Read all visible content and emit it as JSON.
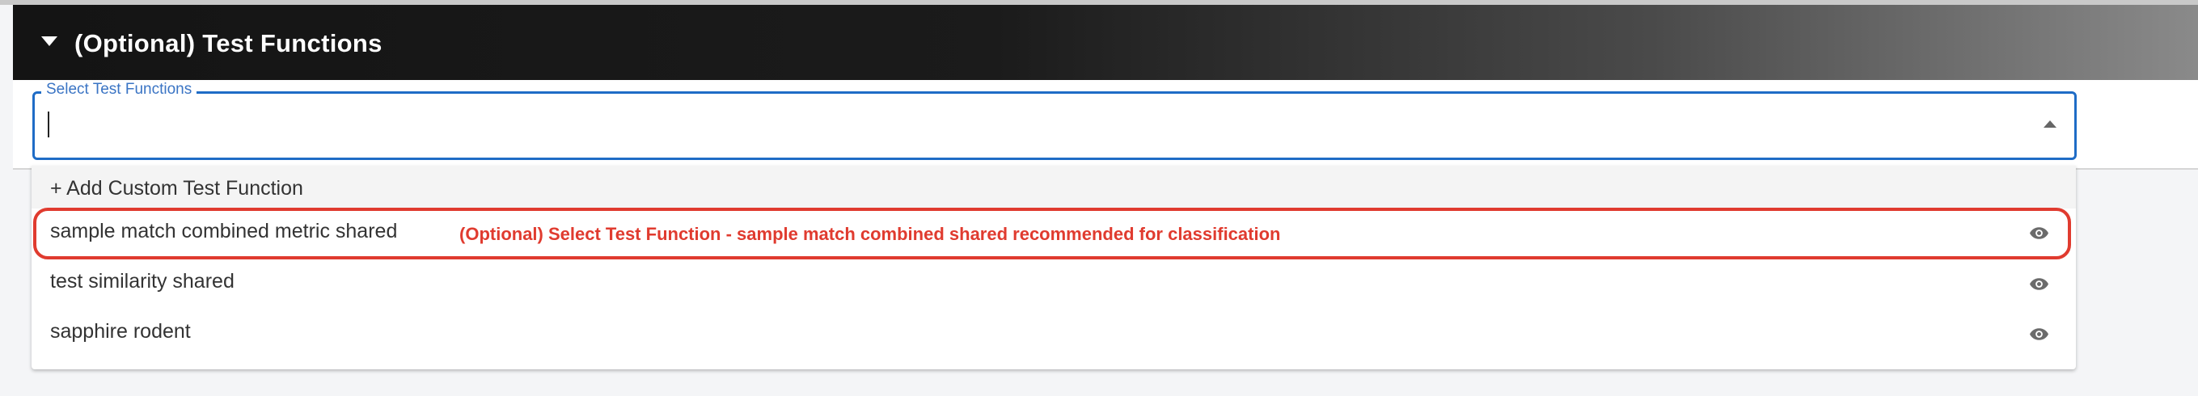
{
  "section": {
    "title": "(Optional) Test Functions"
  },
  "select": {
    "label": "Select Test Functions",
    "value": ""
  },
  "dropdown": {
    "add_custom_label": "+ Add Custom Test Function",
    "options": [
      {
        "label": "sample match combined metric shared",
        "icon": "eye-icon"
      },
      {
        "label": "test similarity shared",
        "icon": "eye-icon"
      },
      {
        "label": "sapphire rodent",
        "icon": "eye-icon"
      }
    ]
  },
  "annotation": {
    "text": "(Optional) Select Test Function - sample match combined shared recommended for classification",
    "color": "#e03b2f"
  },
  "colors": {
    "accent": "#1f6cc6",
    "header_dark": "#141414"
  }
}
